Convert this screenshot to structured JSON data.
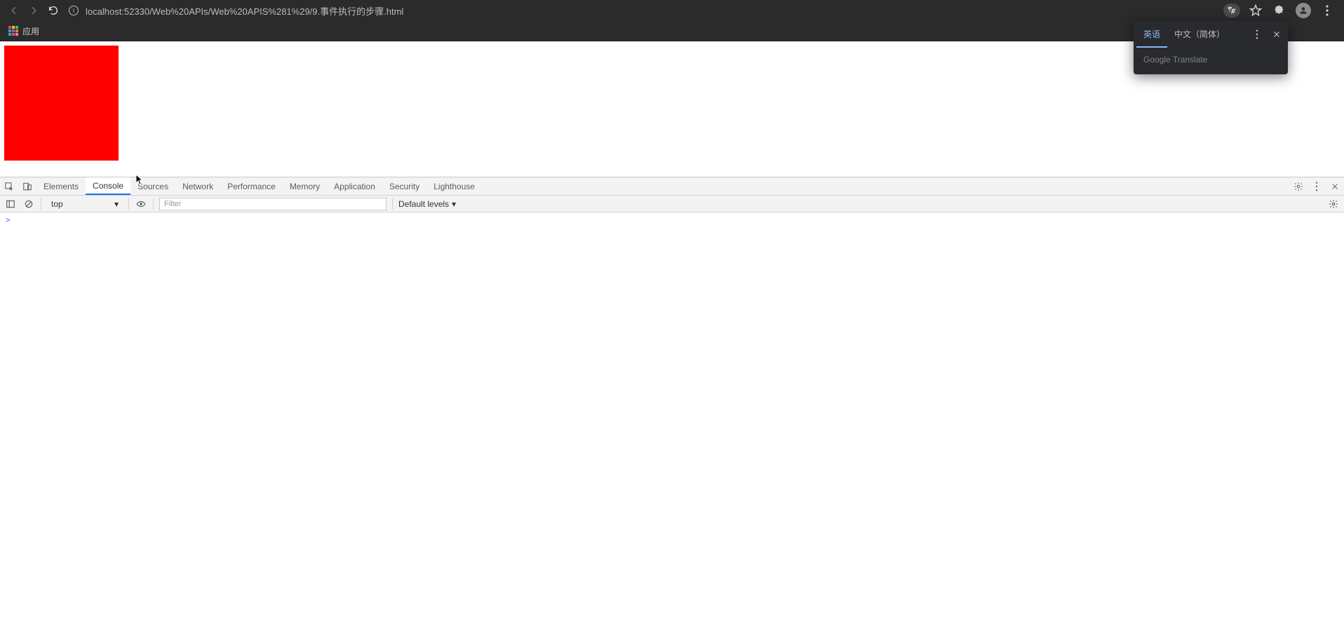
{
  "browser": {
    "url": "localhost:52330/Web%20APIs/Web%20APIS%281%29/9.事件执行的步骤.html"
  },
  "bookmarks": {
    "apps_label": "应用"
  },
  "translate_popup": {
    "tab_active": "英语",
    "tab_other": "中文（简体）",
    "body_text": "Google Translate"
  },
  "devtools": {
    "tabs": [
      "Elements",
      "Console",
      "Sources",
      "Network",
      "Performance",
      "Memory",
      "Application",
      "Security",
      "Lighthouse"
    ],
    "active_tab": "Console",
    "console_toolbar": {
      "context": "top",
      "filter_placeholder": "Filter",
      "levels_label": "Default levels"
    },
    "prompt": ">"
  }
}
